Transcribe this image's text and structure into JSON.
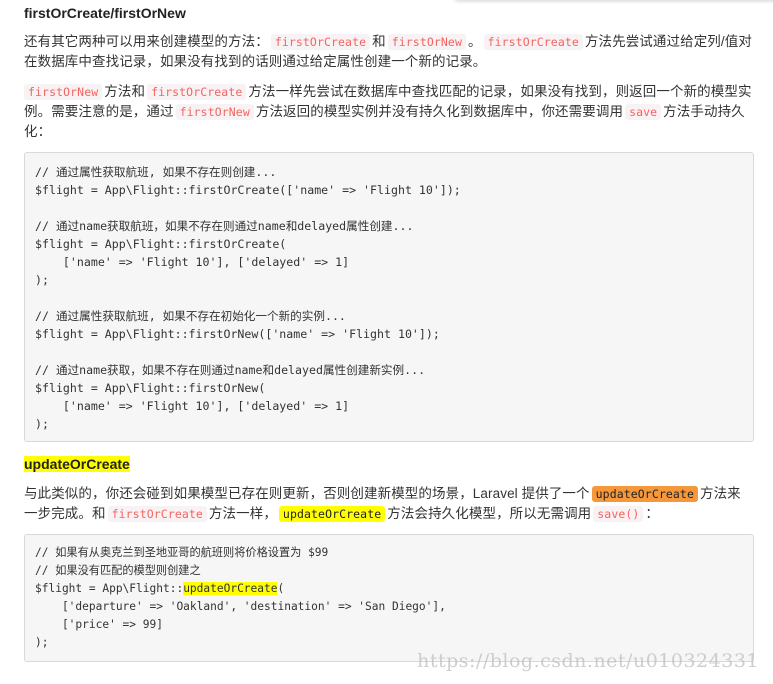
{
  "section1": {
    "heading": "firstOrCreate/firstOrNew",
    "para1": {
      "t1": "还有其它两种可以用来创建模型的方法：",
      "c1": "firstOrCreate",
      "t2": "和",
      "c2": "firstOrNew",
      "t3": "。",
      "c3": "firstOrCreate",
      "t4": "方法先尝试通过给定列/值对在数据库中查找记录，如果没有找到的话则通过给定属性创建一个新的记录。"
    },
    "para2": {
      "c1": "firstOrNew",
      "t1": "方法和",
      "c2": "firstOrCreate",
      "t2": "方法一样先尝试在数据库中查找匹配的记录，如果没有找到，则返回一个新的模型实例。需要注意的是，通过",
      "c3": "firstOrNew",
      "t3": "方法返回的模型实例并没有持久化到数据库中，你还需要调用",
      "c4": "save",
      "t4": "方法手动持久化："
    },
    "code_lines": [
      "// 通过属性获取航班, 如果不存在则创建...",
      "$flight = App\\Flight::firstOrCreate(['name' => 'Flight 10']);",
      "",
      "// 通过name获取航班，如果不存在则通过name和delayed属性创建...",
      "$flight = App\\Flight::firstOrCreate(",
      "    ['name' => 'Flight 10'], ['delayed' => 1]",
      ");",
      "",
      "// 通过属性获取航班, 如果不存在初始化一个新的实例...",
      "$flight = App\\Flight::firstOrNew(['name' => 'Flight 10']);",
      "",
      "// 通过name获取，如果不存在则通过name和delayed属性创建新实例...",
      "$flight = App\\Flight::firstOrNew(",
      "    ['name' => 'Flight 10'], ['delayed' => 1]",
      ");"
    ]
  },
  "section2": {
    "heading": "updateOrCreate",
    "para1": {
      "t1": "与此类似的，你还会碰到如果模型已存在则更新，否则创建新模型的场景，Laravel 提供了一个",
      "c1": "updateOrCreate",
      "t2": "方法来一步完成。和",
      "c2": "firstOrCreate",
      "t3": "方法一样，",
      "c3": "updateOrCreate",
      "t4": "方法会持久化模型，所以无需调用",
      "c4": "save()",
      "t5": "："
    },
    "code": {
      "line1": "// 如果有从奥克兰到圣地亚哥的航班则将价格设置为 $99",
      "line2": "// 如果没有匹配的模型则创建之",
      "line3_prefix": "$flight = App\\Flight::",
      "line3_highlight": "updateOrCreate",
      "line3_suffix": "(",
      "line4": "    ['departure' => 'Oakland', 'destination' => 'San Diego'],",
      "line5": "    ['price' => 99]",
      "line6": ");"
    }
  },
  "highlight_colors": {
    "yellow": "#ffff00",
    "orange": "#f5973b",
    "inline_code_text": "#f4645f"
  },
  "watermark": "https://blog.csdn.net/u010324331"
}
